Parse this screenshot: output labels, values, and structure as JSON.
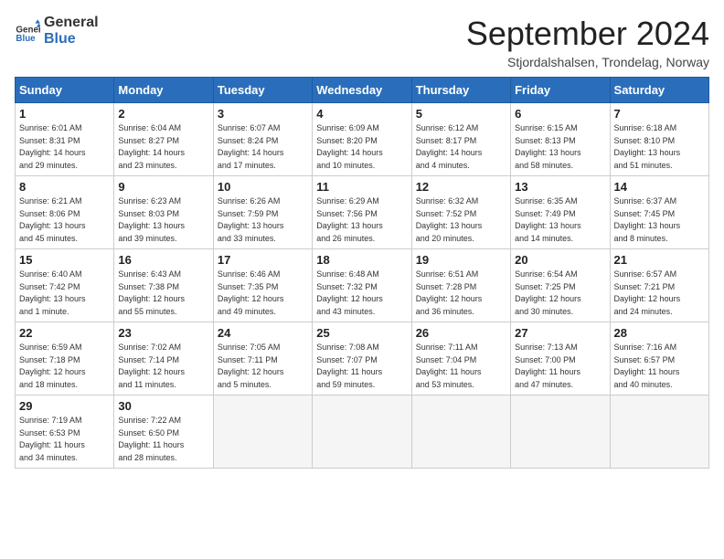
{
  "logo": {
    "general": "General",
    "blue": "Blue"
  },
  "title": "September 2024",
  "location": "Stjordalshalsen, Trondelag, Norway",
  "days_of_week": [
    "Sunday",
    "Monday",
    "Tuesday",
    "Wednesday",
    "Thursday",
    "Friday",
    "Saturday"
  ],
  "weeks": [
    [
      {
        "day": 1,
        "info": "Sunrise: 6:01 AM\nSunset: 8:31 PM\nDaylight: 14 hours\nand 29 minutes."
      },
      {
        "day": 2,
        "info": "Sunrise: 6:04 AM\nSunset: 8:27 PM\nDaylight: 14 hours\nand 23 minutes."
      },
      {
        "day": 3,
        "info": "Sunrise: 6:07 AM\nSunset: 8:24 PM\nDaylight: 14 hours\nand 17 minutes."
      },
      {
        "day": 4,
        "info": "Sunrise: 6:09 AM\nSunset: 8:20 PM\nDaylight: 14 hours\nand 10 minutes."
      },
      {
        "day": 5,
        "info": "Sunrise: 6:12 AM\nSunset: 8:17 PM\nDaylight: 14 hours\nand 4 minutes."
      },
      {
        "day": 6,
        "info": "Sunrise: 6:15 AM\nSunset: 8:13 PM\nDaylight: 13 hours\nand 58 minutes."
      },
      {
        "day": 7,
        "info": "Sunrise: 6:18 AM\nSunset: 8:10 PM\nDaylight: 13 hours\nand 51 minutes."
      }
    ],
    [
      {
        "day": 8,
        "info": "Sunrise: 6:21 AM\nSunset: 8:06 PM\nDaylight: 13 hours\nand 45 minutes."
      },
      {
        "day": 9,
        "info": "Sunrise: 6:23 AM\nSunset: 8:03 PM\nDaylight: 13 hours\nand 39 minutes."
      },
      {
        "day": 10,
        "info": "Sunrise: 6:26 AM\nSunset: 7:59 PM\nDaylight: 13 hours\nand 33 minutes."
      },
      {
        "day": 11,
        "info": "Sunrise: 6:29 AM\nSunset: 7:56 PM\nDaylight: 13 hours\nand 26 minutes."
      },
      {
        "day": 12,
        "info": "Sunrise: 6:32 AM\nSunset: 7:52 PM\nDaylight: 13 hours\nand 20 minutes."
      },
      {
        "day": 13,
        "info": "Sunrise: 6:35 AM\nSunset: 7:49 PM\nDaylight: 13 hours\nand 14 minutes."
      },
      {
        "day": 14,
        "info": "Sunrise: 6:37 AM\nSunset: 7:45 PM\nDaylight: 13 hours\nand 8 minutes."
      }
    ],
    [
      {
        "day": 15,
        "info": "Sunrise: 6:40 AM\nSunset: 7:42 PM\nDaylight: 13 hours\nand 1 minute."
      },
      {
        "day": 16,
        "info": "Sunrise: 6:43 AM\nSunset: 7:38 PM\nDaylight: 12 hours\nand 55 minutes."
      },
      {
        "day": 17,
        "info": "Sunrise: 6:46 AM\nSunset: 7:35 PM\nDaylight: 12 hours\nand 49 minutes."
      },
      {
        "day": 18,
        "info": "Sunrise: 6:48 AM\nSunset: 7:32 PM\nDaylight: 12 hours\nand 43 minutes."
      },
      {
        "day": 19,
        "info": "Sunrise: 6:51 AM\nSunset: 7:28 PM\nDaylight: 12 hours\nand 36 minutes."
      },
      {
        "day": 20,
        "info": "Sunrise: 6:54 AM\nSunset: 7:25 PM\nDaylight: 12 hours\nand 30 minutes."
      },
      {
        "day": 21,
        "info": "Sunrise: 6:57 AM\nSunset: 7:21 PM\nDaylight: 12 hours\nand 24 minutes."
      }
    ],
    [
      {
        "day": 22,
        "info": "Sunrise: 6:59 AM\nSunset: 7:18 PM\nDaylight: 12 hours\nand 18 minutes."
      },
      {
        "day": 23,
        "info": "Sunrise: 7:02 AM\nSunset: 7:14 PM\nDaylight: 12 hours\nand 11 minutes."
      },
      {
        "day": 24,
        "info": "Sunrise: 7:05 AM\nSunset: 7:11 PM\nDaylight: 12 hours\nand 5 minutes."
      },
      {
        "day": 25,
        "info": "Sunrise: 7:08 AM\nSunset: 7:07 PM\nDaylight: 11 hours\nand 59 minutes."
      },
      {
        "day": 26,
        "info": "Sunrise: 7:11 AM\nSunset: 7:04 PM\nDaylight: 11 hours\nand 53 minutes."
      },
      {
        "day": 27,
        "info": "Sunrise: 7:13 AM\nSunset: 7:00 PM\nDaylight: 11 hours\nand 47 minutes."
      },
      {
        "day": 28,
        "info": "Sunrise: 7:16 AM\nSunset: 6:57 PM\nDaylight: 11 hours\nand 40 minutes."
      }
    ],
    [
      {
        "day": 29,
        "info": "Sunrise: 7:19 AM\nSunset: 6:53 PM\nDaylight: 11 hours\nand 34 minutes."
      },
      {
        "day": 30,
        "info": "Sunrise: 7:22 AM\nSunset: 6:50 PM\nDaylight: 11 hours\nand 28 minutes."
      },
      null,
      null,
      null,
      null,
      null
    ]
  ]
}
